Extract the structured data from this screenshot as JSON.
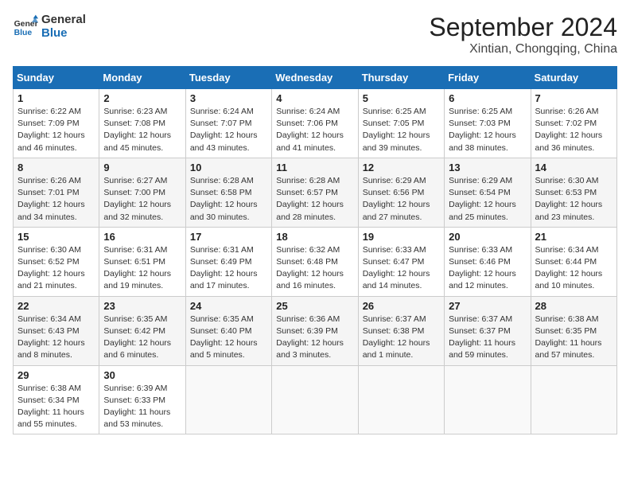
{
  "header": {
    "logo_general": "General",
    "logo_blue": "Blue",
    "month_title": "September 2024",
    "location": "Xintian, Chongqing, China"
  },
  "weekdays": [
    "Sunday",
    "Monday",
    "Tuesday",
    "Wednesday",
    "Thursday",
    "Friday",
    "Saturday"
  ],
  "weeks": [
    [
      {
        "day": "1",
        "sunrise": "Sunrise: 6:22 AM",
        "sunset": "Sunset: 7:09 PM",
        "daylight": "Daylight: 12 hours and 46 minutes."
      },
      {
        "day": "2",
        "sunrise": "Sunrise: 6:23 AM",
        "sunset": "Sunset: 7:08 PM",
        "daylight": "Daylight: 12 hours and 45 minutes."
      },
      {
        "day": "3",
        "sunrise": "Sunrise: 6:24 AM",
        "sunset": "Sunset: 7:07 PM",
        "daylight": "Daylight: 12 hours and 43 minutes."
      },
      {
        "day": "4",
        "sunrise": "Sunrise: 6:24 AM",
        "sunset": "Sunset: 7:06 PM",
        "daylight": "Daylight: 12 hours and 41 minutes."
      },
      {
        "day": "5",
        "sunrise": "Sunrise: 6:25 AM",
        "sunset": "Sunset: 7:05 PM",
        "daylight": "Daylight: 12 hours and 39 minutes."
      },
      {
        "day": "6",
        "sunrise": "Sunrise: 6:25 AM",
        "sunset": "Sunset: 7:03 PM",
        "daylight": "Daylight: 12 hours and 38 minutes."
      },
      {
        "day": "7",
        "sunrise": "Sunrise: 6:26 AM",
        "sunset": "Sunset: 7:02 PM",
        "daylight": "Daylight: 12 hours and 36 minutes."
      }
    ],
    [
      {
        "day": "8",
        "sunrise": "Sunrise: 6:26 AM",
        "sunset": "Sunset: 7:01 PM",
        "daylight": "Daylight: 12 hours and 34 minutes."
      },
      {
        "day": "9",
        "sunrise": "Sunrise: 6:27 AM",
        "sunset": "Sunset: 7:00 PM",
        "daylight": "Daylight: 12 hours and 32 minutes."
      },
      {
        "day": "10",
        "sunrise": "Sunrise: 6:28 AM",
        "sunset": "Sunset: 6:58 PM",
        "daylight": "Daylight: 12 hours and 30 minutes."
      },
      {
        "day": "11",
        "sunrise": "Sunrise: 6:28 AM",
        "sunset": "Sunset: 6:57 PM",
        "daylight": "Daylight: 12 hours and 28 minutes."
      },
      {
        "day": "12",
        "sunrise": "Sunrise: 6:29 AM",
        "sunset": "Sunset: 6:56 PM",
        "daylight": "Daylight: 12 hours and 27 minutes."
      },
      {
        "day": "13",
        "sunrise": "Sunrise: 6:29 AM",
        "sunset": "Sunset: 6:54 PM",
        "daylight": "Daylight: 12 hours and 25 minutes."
      },
      {
        "day": "14",
        "sunrise": "Sunrise: 6:30 AM",
        "sunset": "Sunset: 6:53 PM",
        "daylight": "Daylight: 12 hours and 23 minutes."
      }
    ],
    [
      {
        "day": "15",
        "sunrise": "Sunrise: 6:30 AM",
        "sunset": "Sunset: 6:52 PM",
        "daylight": "Daylight: 12 hours and 21 minutes."
      },
      {
        "day": "16",
        "sunrise": "Sunrise: 6:31 AM",
        "sunset": "Sunset: 6:51 PM",
        "daylight": "Daylight: 12 hours and 19 minutes."
      },
      {
        "day": "17",
        "sunrise": "Sunrise: 6:31 AM",
        "sunset": "Sunset: 6:49 PM",
        "daylight": "Daylight: 12 hours and 17 minutes."
      },
      {
        "day": "18",
        "sunrise": "Sunrise: 6:32 AM",
        "sunset": "Sunset: 6:48 PM",
        "daylight": "Daylight: 12 hours and 16 minutes."
      },
      {
        "day": "19",
        "sunrise": "Sunrise: 6:33 AM",
        "sunset": "Sunset: 6:47 PM",
        "daylight": "Daylight: 12 hours and 14 minutes."
      },
      {
        "day": "20",
        "sunrise": "Sunrise: 6:33 AM",
        "sunset": "Sunset: 6:46 PM",
        "daylight": "Daylight: 12 hours and 12 minutes."
      },
      {
        "day": "21",
        "sunrise": "Sunrise: 6:34 AM",
        "sunset": "Sunset: 6:44 PM",
        "daylight": "Daylight: 12 hours and 10 minutes."
      }
    ],
    [
      {
        "day": "22",
        "sunrise": "Sunrise: 6:34 AM",
        "sunset": "Sunset: 6:43 PM",
        "daylight": "Daylight: 12 hours and 8 minutes."
      },
      {
        "day": "23",
        "sunrise": "Sunrise: 6:35 AM",
        "sunset": "Sunset: 6:42 PM",
        "daylight": "Daylight: 12 hours and 6 minutes."
      },
      {
        "day": "24",
        "sunrise": "Sunrise: 6:35 AM",
        "sunset": "Sunset: 6:40 PM",
        "daylight": "Daylight: 12 hours and 5 minutes."
      },
      {
        "day": "25",
        "sunrise": "Sunrise: 6:36 AM",
        "sunset": "Sunset: 6:39 PM",
        "daylight": "Daylight: 12 hours and 3 minutes."
      },
      {
        "day": "26",
        "sunrise": "Sunrise: 6:37 AM",
        "sunset": "Sunset: 6:38 PM",
        "daylight": "Daylight: 12 hours and 1 minute."
      },
      {
        "day": "27",
        "sunrise": "Sunrise: 6:37 AM",
        "sunset": "Sunset: 6:37 PM",
        "daylight": "Daylight: 11 hours and 59 minutes."
      },
      {
        "day": "28",
        "sunrise": "Sunrise: 6:38 AM",
        "sunset": "Sunset: 6:35 PM",
        "daylight": "Daylight: 11 hours and 57 minutes."
      }
    ],
    [
      {
        "day": "29",
        "sunrise": "Sunrise: 6:38 AM",
        "sunset": "Sunset: 6:34 PM",
        "daylight": "Daylight: 11 hours and 55 minutes."
      },
      {
        "day": "30",
        "sunrise": "Sunrise: 6:39 AM",
        "sunset": "Sunset: 6:33 PM",
        "daylight": "Daylight: 11 hours and 53 minutes."
      },
      null,
      null,
      null,
      null,
      null
    ]
  ]
}
